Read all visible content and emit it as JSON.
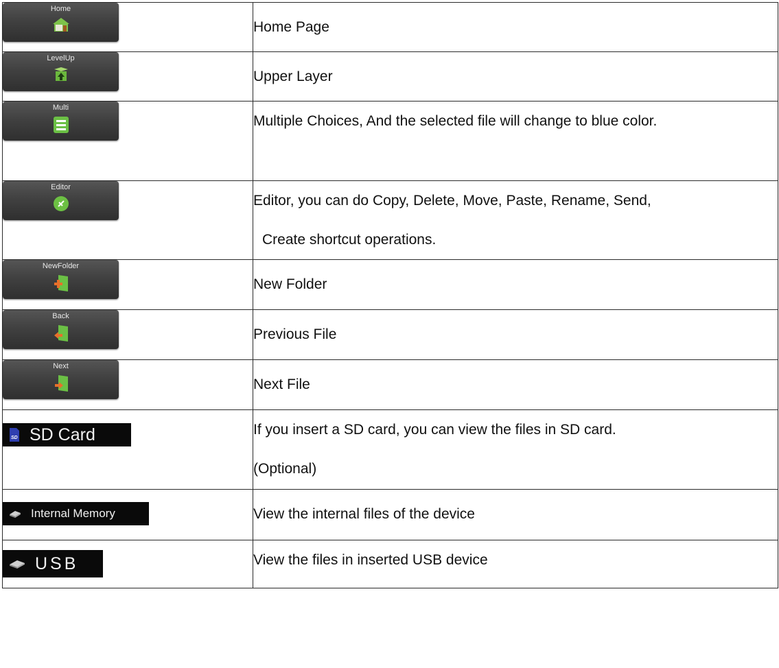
{
  "rows": [
    {
      "button_label": "Home",
      "icon": "home-icon",
      "description": "Home Page"
    },
    {
      "button_label": "LevelUp",
      "icon": "level-up-icon",
      "description": "Upper Layer"
    },
    {
      "button_label": "Multi",
      "icon": "multi-select-icon",
      "description": "Multiple Choices, And the selected file will change to blue color."
    },
    {
      "button_label": "Editor",
      "icon": "editor-icon",
      "description": "Editor, you can do Copy, Delete, Move, Paste, Rename, Send,",
      "description_2": "Create shortcut operations."
    },
    {
      "button_label": "NewFolder",
      "icon": "new-folder-icon",
      "description": "New Folder"
    },
    {
      "button_label": "Back",
      "icon": "back-icon",
      "description": "Previous File"
    },
    {
      "button_label": "Next",
      "icon": "next-icon",
      "description": "Next File"
    },
    {
      "button_label": "SD Card",
      "icon": "sd-card-icon",
      "description": "If you insert a SD card, you can view the files in SD card.",
      "description_2": "(Optional)"
    },
    {
      "button_label": "Internal Memory",
      "icon": "internal-memory-icon",
      "description": "View the internal files of the device"
    },
    {
      "button_label": "USB",
      "icon": "usb-drive-icon",
      "description": "View the files in inserted USB device"
    }
  ],
  "colors": {
    "button_bg": "#3f3f3f",
    "icon_green": "#5cb83a",
    "icon_orange": "#e8702a",
    "source_bg": "#0a0a0a"
  }
}
